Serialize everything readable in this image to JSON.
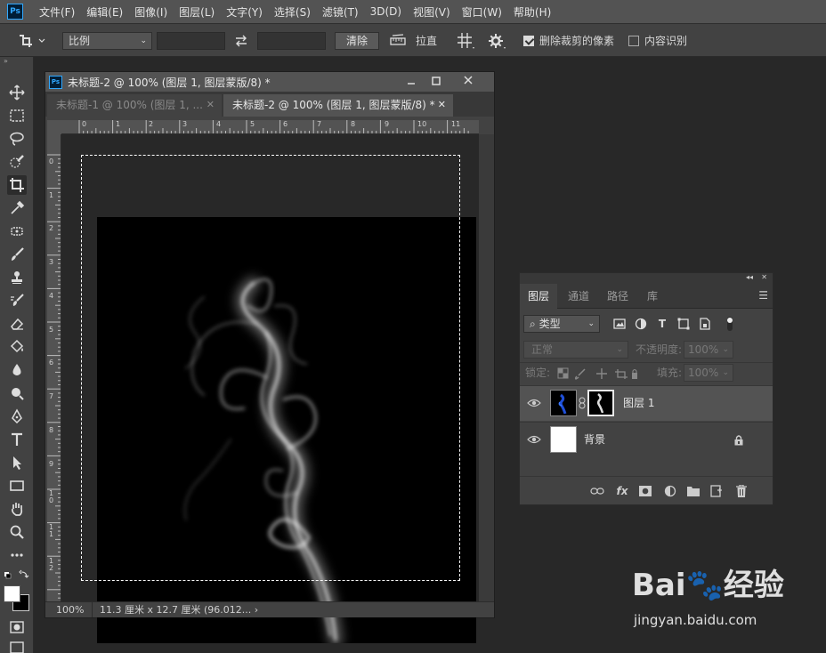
{
  "menu": [
    "文件(F)",
    "编辑(E)",
    "图像(I)",
    "图层(L)",
    "文字(Y)",
    "选择(S)",
    "滤镜(T)",
    "3D(D)",
    "视图(V)",
    "窗口(W)",
    "帮助(H)"
  ],
  "app_logo": "Ps",
  "options": {
    "ratio_select": "比例",
    "clear_button": "清除",
    "straighten_label": "拉直",
    "delete_cropped_label": "删除裁剪的像素",
    "delete_cropped_checked": true,
    "content_aware_label": "内容识别",
    "content_aware_checked": false
  },
  "document": {
    "window_title": "未标题-2 @ 100% (图层 1, 图层蒙版/8) *",
    "tabs": [
      {
        "label": "未标题-1 @ 100% (图层 1, ...",
        "active": false
      },
      {
        "label": "未标题-2 @ 100% (图层 1, 图层蒙版/8) *",
        "active": true
      }
    ],
    "ruler_h": [
      "0",
      "1",
      "2",
      "3",
      "4",
      "5",
      "6",
      "7",
      "8",
      "9",
      "10",
      "11"
    ],
    "ruler_v": [
      "0",
      "1",
      "2",
      "3",
      "4",
      "5",
      "6",
      "7",
      "8",
      "9",
      "1 0",
      "1 1",
      "1 2"
    ],
    "zoom": "100%",
    "size_info": "11.3 厘米 x 12.7 厘米 (96.012...",
    "size_arrow": "›"
  },
  "layers_panel": {
    "tabs": [
      "图层",
      "通道",
      "路径",
      "库"
    ],
    "active_tab": "图层",
    "filter_label": "类型",
    "blend_mode": "正常",
    "opacity_label": "不透明度:",
    "opacity_value": "100%",
    "lock_label": "锁定:",
    "fill_label": "填充:",
    "fill_value": "100%",
    "layers": [
      {
        "name": "图层 1",
        "selected": true,
        "has_mask": true,
        "locked": false
      },
      {
        "name": "背景",
        "selected": false,
        "has_mask": false,
        "locked": true
      }
    ]
  },
  "watermark": {
    "text": "Bai🐾经验",
    "url": "jingyan.baidu.com"
  },
  "colors": {
    "ps_blue": "#31a8ff",
    "panel_bg": "#424242",
    "menu_bg": "#535353",
    "workspace_bg": "#282828",
    "layer_1_thumb_accent": "#1f4fd8"
  }
}
